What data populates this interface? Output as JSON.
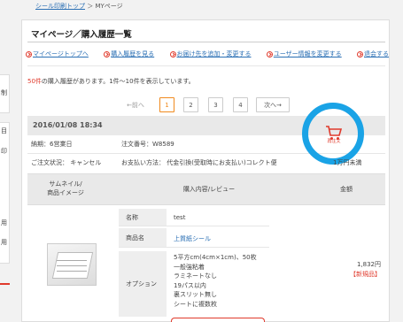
{
  "breadcrumb": {
    "home": "シール印刷トップ",
    "sep": "＞",
    "current": "MYページ"
  },
  "sidebar_chars": [
    "制",
    "目",
    "印",
    "用",
    "用"
  ],
  "page_title": "マイページ／購入履歴一覧",
  "menu": [
    {
      "label": "マイページトップへ"
    },
    {
      "label": "購入履歴を見る"
    },
    {
      "label": "お届け先を追加・変更する"
    },
    {
      "label": "ユーザー情報を変更する"
    },
    {
      "label": "退会する"
    }
  ],
  "summary": {
    "count": "50件",
    "text": "の購入履歴があります。1件〜10件を表示しています。"
  },
  "pager": {
    "prev": "←前へ",
    "pages": [
      "1",
      "2",
      "3",
      "4"
    ],
    "active": "1",
    "next": "次へ→"
  },
  "order": {
    "date": "2016/01/08 18:34",
    "payment_status": "納期：6営業日",
    "order_number": "注文番号：W8589",
    "order_status": "ご注文状況： キャンセル",
    "payment_method": "お支払い方法： 代金引換(受取時にお支払い)コレクト便",
    "payment_tail": "1万円未満"
  },
  "table_head": {
    "thumb": "サムネイル/\n商品イメージ",
    "content": "購入内容/レビュー",
    "amount": "金額"
  },
  "detail": {
    "name_label": "名称",
    "name_value": "test",
    "product_label": "商品名",
    "product_value": "上質紙シール",
    "option_label": "オプション",
    "option_lines": [
      "5平方cm(4cm×1cm)、50枚",
      "一般強粘着",
      "ラミネートなし",
      "19パス以内",
      "裏スリット無し",
      "シートに複数枚"
    ]
  },
  "price": "1,832円",
  "badge": "【新規品】",
  "reorder": {
    "label": "再注文",
    "icon": "cart-icon",
    "highlight_color": "#1aa3e6"
  },
  "colors": {
    "accent": "#e03a2c",
    "link": "#2a6fb4",
    "pager_active": "#f08a1e"
  }
}
